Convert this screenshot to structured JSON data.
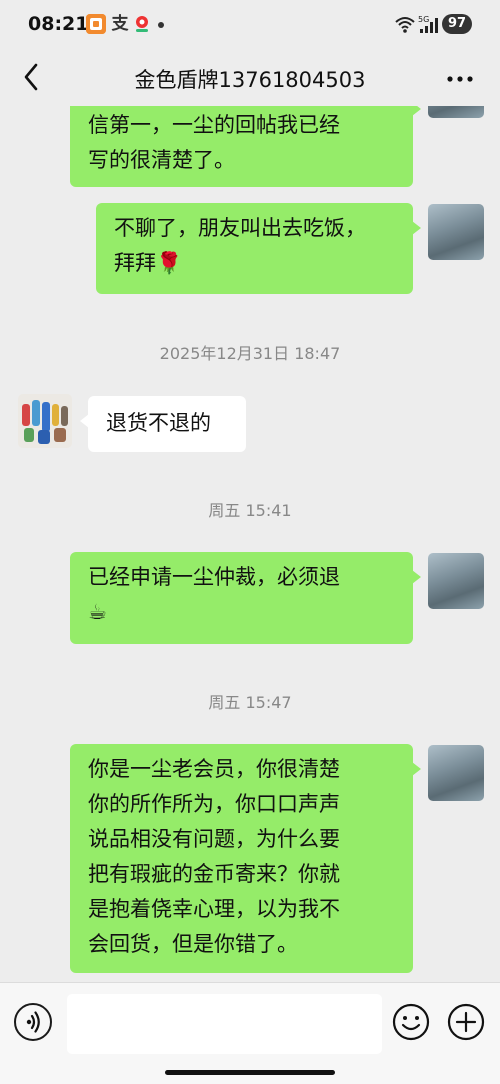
{
  "status_bar": {
    "time": "08:21",
    "notif_alipay": "支",
    "network_label": "5G",
    "battery": "97"
  },
  "header": {
    "title": "金色盾牌13761804503"
  },
  "messages": [
    {
      "from": "me",
      "lines": [
        "信第一，一尘的回帖我已经",
        "写的很清楚了。"
      ]
    },
    {
      "from": "me",
      "lines": [
        "不聊了，朋友叫出去吃饭，",
        "拜拜🌹"
      ]
    },
    {
      "timestamp": "2025年12月31日 18:47"
    },
    {
      "from": "them",
      "lines": [
        "退货不退的"
      ]
    },
    {
      "timestamp": "周五 15:41"
    },
    {
      "from": "me",
      "lines": [
        "已经申请一尘仲裁，必须退",
        "☕"
      ]
    },
    {
      "timestamp": "周五 15:47"
    },
    {
      "from": "me",
      "lines": [
        "你是一尘老会员，你很清楚",
        "你的所作所为，你口口声声",
        "说品相没有问题，为什么要",
        "把有瑕疵的金币寄来？你就",
        "是抱着侥幸心理，以为我不",
        "会回货，但是你错了。"
      ]
    }
  ],
  "input": {
    "value": "",
    "placeholder": ""
  },
  "colors": {
    "background": "#ededed",
    "bubble_me": "#95ec69",
    "bubble_them": "#ffffff",
    "timestamp": "#888888"
  },
  "icons": {
    "back": "chevron-left-icon",
    "more": "more-dots-icon",
    "voice": "voice-icon",
    "emoji": "emoji-icon",
    "plus": "plus-icon"
  }
}
